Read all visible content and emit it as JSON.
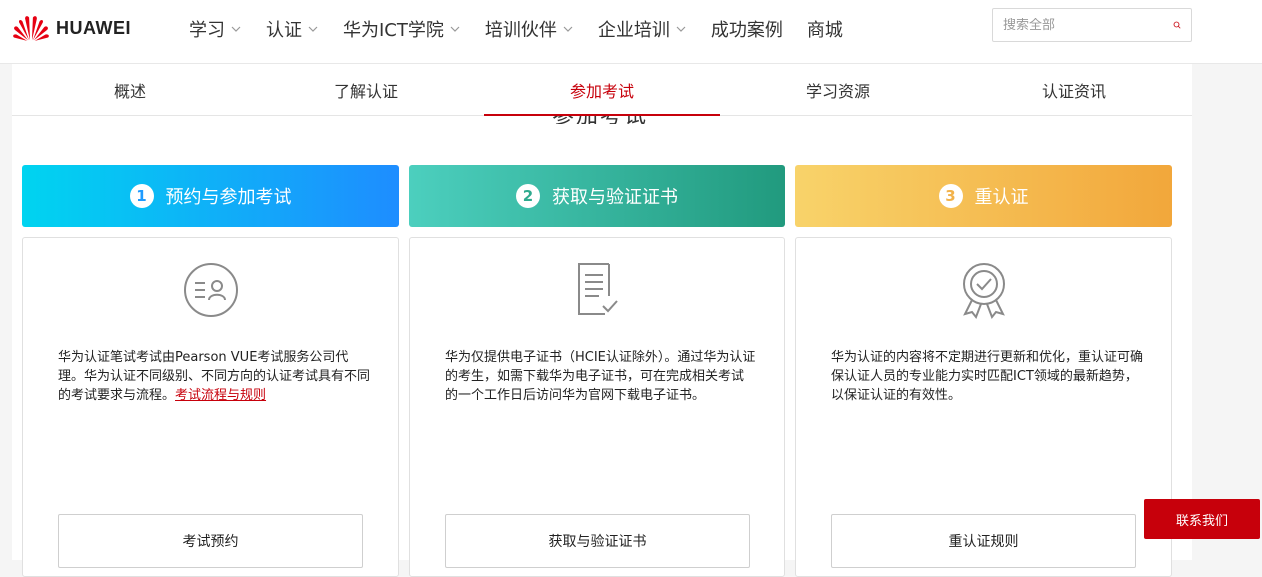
{
  "header": {
    "logo_text": "HUAWEI",
    "menu": [
      {
        "label": "学习",
        "has_dropdown": true
      },
      {
        "label": "认证",
        "has_dropdown": true
      },
      {
        "label": "华为ICT学院",
        "has_dropdown": true
      },
      {
        "label": "培训伙伴",
        "has_dropdown": true
      },
      {
        "label": "企业培训",
        "has_dropdown": true
      },
      {
        "label": "成功案例",
        "has_dropdown": false
      },
      {
        "label": "商城",
        "has_dropdown": false
      }
    ],
    "search": {
      "placeholder": "搜索全部",
      "value": ""
    }
  },
  "subnav": {
    "tabs": [
      {
        "label": "概述"
      },
      {
        "label": "了解认证"
      },
      {
        "label": "参加考试",
        "active": true
      },
      {
        "label": "学习资源"
      },
      {
        "label": "认证资讯"
      }
    ]
  },
  "section_title_peek": "参加考试",
  "steps": [
    {
      "number": "1",
      "title": "预约与参加考试",
      "icon": "exam-person-icon",
      "desc": "华为认证笔试考试由Pearson VUE考试服务公司代理。华为认证不同级别、不同方向的认证考试具有不同的考试要求与流程。",
      "link": "考试流程与规则",
      "button": "考试预约"
    },
    {
      "number": "2",
      "title": "获取与验证证书",
      "icon": "certificate-document-icon",
      "desc": "华为仅提供电子证书（HCIE认证除外）。通过华为认证的考生，如需下载华为电子证书，可在完成相关考试的一个工作日后访问华为官网下载电子证书。",
      "button": "获取与验证证书"
    },
    {
      "number": "3",
      "title": "重认证",
      "icon": "award-badge-icon",
      "desc": "华为认证的内容将不定期进行更新和优化，重认证可确保认证人员的专业能力实时匹配ICT领域的最新趋势，以保证认证的有效性。",
      "button": "重认证规则"
    }
  ],
  "contact_button": "联系我们",
  "colors": {
    "brand_red": "#c7000b",
    "step1": "#1e8dff",
    "step2": "#219a7e",
    "step3": "#f2a73b"
  }
}
